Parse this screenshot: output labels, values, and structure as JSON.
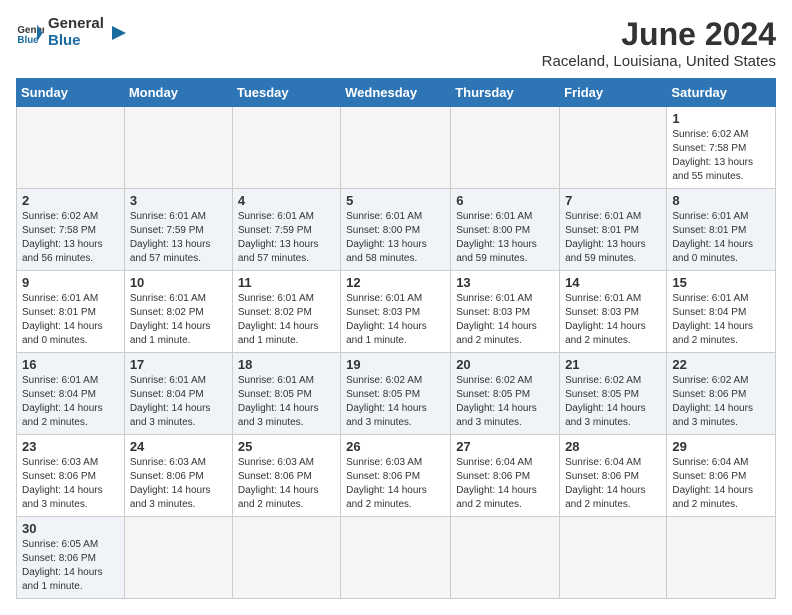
{
  "header": {
    "logo_text_general": "General",
    "logo_text_blue": "Blue",
    "month": "June 2024",
    "location": "Raceland, Louisiana, United States"
  },
  "weekdays": [
    "Sunday",
    "Monday",
    "Tuesday",
    "Wednesday",
    "Thursday",
    "Friday",
    "Saturday"
  ],
  "weeks": [
    {
      "days": [
        {
          "num": "",
          "info": ""
        },
        {
          "num": "",
          "info": ""
        },
        {
          "num": "",
          "info": ""
        },
        {
          "num": "",
          "info": ""
        },
        {
          "num": "",
          "info": ""
        },
        {
          "num": "",
          "info": ""
        },
        {
          "num": "1",
          "info": "Sunrise: 6:02 AM\nSunset: 7:58 PM\nDaylight: 13 hours\nand 55 minutes."
        }
      ]
    },
    {
      "days": [
        {
          "num": "2",
          "info": "Sunrise: 6:02 AM\nSunset: 7:58 PM\nDaylight: 13 hours\nand 56 minutes."
        },
        {
          "num": "3",
          "info": "Sunrise: 6:01 AM\nSunset: 7:59 PM\nDaylight: 13 hours\nand 57 minutes."
        },
        {
          "num": "4",
          "info": "Sunrise: 6:01 AM\nSunset: 7:59 PM\nDaylight: 13 hours\nand 57 minutes."
        },
        {
          "num": "5",
          "info": "Sunrise: 6:01 AM\nSunset: 8:00 PM\nDaylight: 13 hours\nand 58 minutes."
        },
        {
          "num": "6",
          "info": "Sunrise: 6:01 AM\nSunset: 8:00 PM\nDaylight: 13 hours\nand 59 minutes."
        },
        {
          "num": "7",
          "info": "Sunrise: 6:01 AM\nSunset: 8:01 PM\nDaylight: 13 hours\nand 59 minutes."
        },
        {
          "num": "8",
          "info": "Sunrise: 6:01 AM\nSunset: 8:01 PM\nDaylight: 14 hours\nand 0 minutes."
        }
      ]
    },
    {
      "days": [
        {
          "num": "9",
          "info": "Sunrise: 6:01 AM\nSunset: 8:01 PM\nDaylight: 14 hours\nand 0 minutes."
        },
        {
          "num": "10",
          "info": "Sunrise: 6:01 AM\nSunset: 8:02 PM\nDaylight: 14 hours\nand 1 minute."
        },
        {
          "num": "11",
          "info": "Sunrise: 6:01 AM\nSunset: 8:02 PM\nDaylight: 14 hours\nand 1 minute."
        },
        {
          "num": "12",
          "info": "Sunrise: 6:01 AM\nSunset: 8:03 PM\nDaylight: 14 hours\nand 1 minute."
        },
        {
          "num": "13",
          "info": "Sunrise: 6:01 AM\nSunset: 8:03 PM\nDaylight: 14 hours\nand 2 minutes."
        },
        {
          "num": "14",
          "info": "Sunrise: 6:01 AM\nSunset: 8:03 PM\nDaylight: 14 hours\nand 2 minutes."
        },
        {
          "num": "15",
          "info": "Sunrise: 6:01 AM\nSunset: 8:04 PM\nDaylight: 14 hours\nand 2 minutes."
        }
      ]
    },
    {
      "days": [
        {
          "num": "16",
          "info": "Sunrise: 6:01 AM\nSunset: 8:04 PM\nDaylight: 14 hours\nand 2 minutes."
        },
        {
          "num": "17",
          "info": "Sunrise: 6:01 AM\nSunset: 8:04 PM\nDaylight: 14 hours\nand 3 minutes."
        },
        {
          "num": "18",
          "info": "Sunrise: 6:01 AM\nSunset: 8:05 PM\nDaylight: 14 hours\nand 3 minutes."
        },
        {
          "num": "19",
          "info": "Sunrise: 6:02 AM\nSunset: 8:05 PM\nDaylight: 14 hours\nand 3 minutes."
        },
        {
          "num": "20",
          "info": "Sunrise: 6:02 AM\nSunset: 8:05 PM\nDaylight: 14 hours\nand 3 minutes."
        },
        {
          "num": "21",
          "info": "Sunrise: 6:02 AM\nSunset: 8:05 PM\nDaylight: 14 hours\nand 3 minutes."
        },
        {
          "num": "22",
          "info": "Sunrise: 6:02 AM\nSunset: 8:06 PM\nDaylight: 14 hours\nand 3 minutes."
        }
      ]
    },
    {
      "days": [
        {
          "num": "23",
          "info": "Sunrise: 6:03 AM\nSunset: 8:06 PM\nDaylight: 14 hours\nand 3 minutes."
        },
        {
          "num": "24",
          "info": "Sunrise: 6:03 AM\nSunset: 8:06 PM\nDaylight: 14 hours\nand 3 minutes."
        },
        {
          "num": "25",
          "info": "Sunrise: 6:03 AM\nSunset: 8:06 PM\nDaylight: 14 hours\nand 2 minutes."
        },
        {
          "num": "26",
          "info": "Sunrise: 6:03 AM\nSunset: 8:06 PM\nDaylight: 14 hours\nand 2 minutes."
        },
        {
          "num": "27",
          "info": "Sunrise: 6:04 AM\nSunset: 8:06 PM\nDaylight: 14 hours\nand 2 minutes."
        },
        {
          "num": "28",
          "info": "Sunrise: 6:04 AM\nSunset: 8:06 PM\nDaylight: 14 hours\nand 2 minutes."
        },
        {
          "num": "29",
          "info": "Sunrise: 6:04 AM\nSunset: 8:06 PM\nDaylight: 14 hours\nand 2 minutes."
        }
      ]
    },
    {
      "days": [
        {
          "num": "30",
          "info": "Sunrise: 6:05 AM\nSunset: 8:06 PM\nDaylight: 14 hours\nand 1 minute."
        },
        {
          "num": "",
          "info": ""
        },
        {
          "num": "",
          "info": ""
        },
        {
          "num": "",
          "info": ""
        },
        {
          "num": "",
          "info": ""
        },
        {
          "num": "",
          "info": ""
        },
        {
          "num": "",
          "info": ""
        }
      ]
    }
  ]
}
